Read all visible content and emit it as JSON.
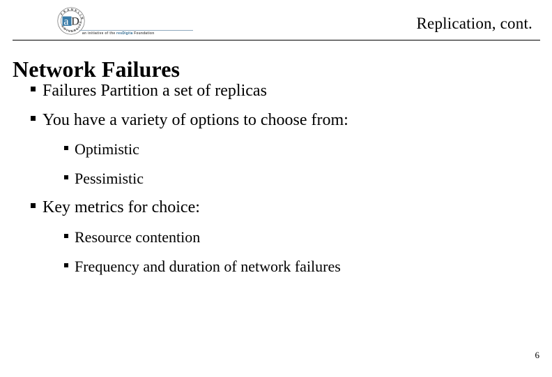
{
  "slide": {
    "header_title": "Replication, cont.",
    "title": "Network Failures",
    "page_number": "6",
    "logo": {
      "seal_letter_a": "a",
      "seal_letter_d": "D",
      "seal_ring_text_top": "FRANKLIN",
      "seal_ring_text_bottom": "UNIVERSITY",
      "tagline_prefix": "an initiative of the ",
      "tagline_brand": "resDigita",
      "tagline_suffix": " Foundation",
      "accent_color": "#3a7ca8",
      "rule_color": "#8fa9bd"
    },
    "bullets": [
      {
        "level": 1,
        "text": "Failures Partition a set of replicas"
      },
      {
        "level": 1,
        "text": "You have a variety of options to choose from:"
      },
      {
        "level": 2,
        "text": "Optimistic"
      },
      {
        "level": 2,
        "text": "Pessimistic"
      },
      {
        "level": 1,
        "text": "Key metrics for choice:"
      },
      {
        "level": 2,
        "text": "Resource contention"
      },
      {
        "level": 2,
        "text": "Frequency and duration of network failures"
      }
    ]
  }
}
